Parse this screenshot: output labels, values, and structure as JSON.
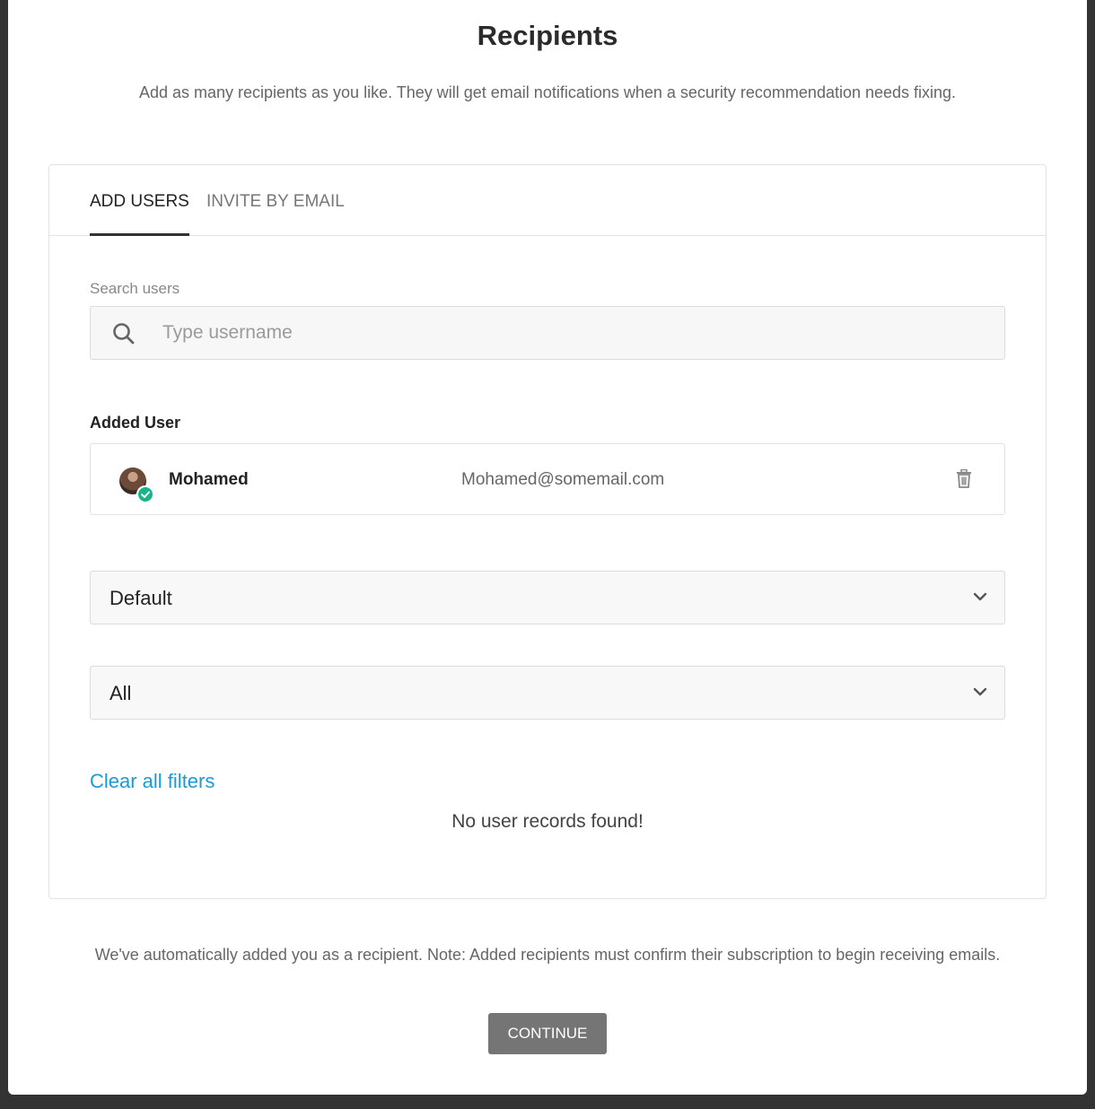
{
  "header": {
    "title": "Recipients",
    "subtitle": "Add as many recipients as you like. They will get email notifications when a security recommendation needs fixing."
  },
  "tabs": [
    {
      "label": "ADD USERS",
      "active": true
    },
    {
      "label": "INVITE BY EMAIL",
      "active": false
    }
  ],
  "search": {
    "label": "Search users",
    "placeholder": "Type username",
    "value": ""
  },
  "added_users": {
    "label": "Added User",
    "items": [
      {
        "name": "Mohamed",
        "email": "Mohamed@somemail.com",
        "verified": true
      }
    ]
  },
  "filters": {
    "first_select": "Default",
    "second_select": "All",
    "clear_label": "Clear all filters"
  },
  "results": {
    "empty_message": "No user records found!"
  },
  "footer": {
    "note": "We've automatically added you as a recipient. Note: Added recipients must confirm their subscription to begin receiving emails.",
    "continue_label": "CONTINUE"
  },
  "colors": {
    "accent_link": "#1a9bd7",
    "verified_badge": "#1bb38a",
    "button_bg": "#757575",
    "backdrop": "#333333"
  },
  "icons": {
    "search": "search-icon",
    "delete": "trash-icon",
    "dropdown": "chevron-down-icon",
    "verified": "check-icon"
  }
}
